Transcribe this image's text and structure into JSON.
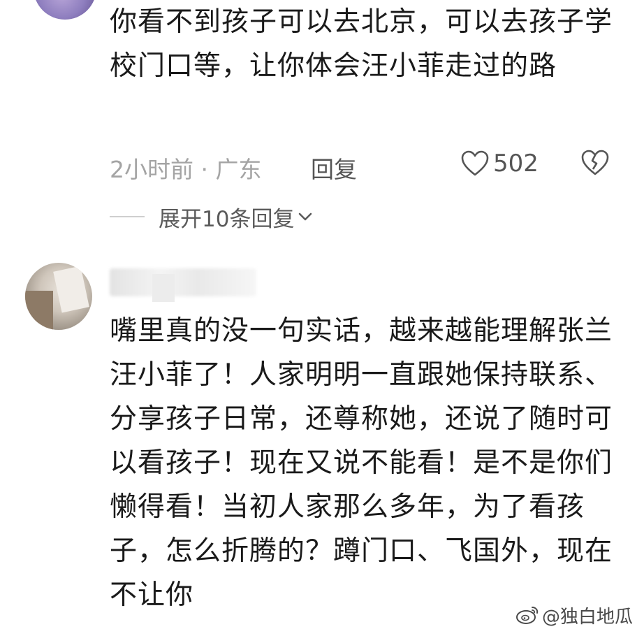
{
  "comment1": {
    "text": "你看不到孩子可以去北京，可以去孩子学校门口等，让你体会汪小菲走过的路",
    "time": "2小时前 · 广东",
    "reply_label": "回复",
    "like_count": "502",
    "expand_label": "展开10条回复"
  },
  "comment2": {
    "text": "嘴里真的没一句实话，越来越能理解张兰汪小菲了！人家明明一直跟她保持联系、分享孩子日常，还尊称她，还说了随时可以看孩子！现在又说不能看！是不是你们懒得看！当初人家那么多年，为了看孩子，怎么折腾的？蹲门口、飞国外，现在不让你"
  },
  "watermark": {
    "text": "@独白地瓜",
    "icon": "weibo-icon"
  },
  "icons": {
    "like": "heart-outline-icon",
    "dislike": "broken-heart-icon",
    "expand": "chevron-down-icon"
  },
  "colors": {
    "text": "#1a1a1a",
    "meta": "#a4a4a4",
    "secondary": "#555555"
  }
}
